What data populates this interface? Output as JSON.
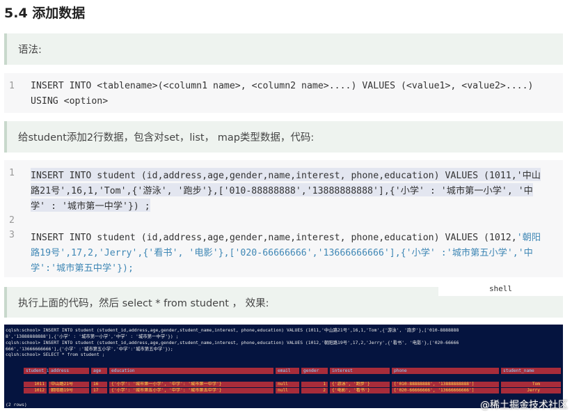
{
  "heading": "5.4 添加数据",
  "callout_syntax": "语法:",
  "syntax_code": {
    "line_numbers": [
      "1"
    ],
    "line1": "INSERT INTO <tablename>(<column1 name>, <column2 name>....) VALUES (<value1>, <value2>....)",
    "line1b": "USING <option>"
  },
  "callout_desc": "给student添加2行数据，包含对set，list， map类型数据，代码:",
  "example_code": {
    "ln1": "1",
    "ln2": "2",
    "ln3": "3",
    "l1a": "INSERT INTO student (id,address,age,gender,name,interest, phone,education) VALUES (1011,'中山",
    "l1b": "路21号',16,1,'Tom',{'游泳', '跑步'},['010-88888888','13888888888'],{'小学' : '城市第一小学', '中",
    "l1c": "学' : '城市第一中学'}) ;",
    "l3a_pre": "INSERT INTO student (id,address,age,gender,name,interest, phone,education) VALUES (1012,",
    "l3a_str": "'朝阳",
    "l3b": "路19号',17,2,'Jerry',{'看书', '电影'},['020-66666666','13666666666'],{'小学' :'城市第五小学','中",
    "l3c": "学':'城市第五中学'});"
  },
  "shell_tag": "shell",
  "callout_run": "执行上面的代码，然后 select * from student ， 效果:",
  "terminal": {
    "lines": [
      "cqlsh:school> INSERT INTO student (student_id,address,age,gender,student_name,interest, phone,education) VALUES (1011,'中山路21号',16,1,'Tom',{'游泳', '跑步'},['010-8888888",
      "8','13888888888'],{'小学' : '城市第一小学','中学' : '城市第一中学'}) ;",
      "cqlsh:school> INSERT INTO student (student_id,address,age,gender,student_name,interest, phone,education) VALUES (1012,'朝阳路19号',17,2,'Jerry',{'看书', '电影'},['020-66666",
      "666','13666666666'],{'小学' :'城市第五小学','中学':'城市第五中学'});",
      "cqlsh:school> SELECT * from student ;"
    ],
    "headers": [
      "student_id",
      "address",
      "age",
      "education",
      "email",
      "gender",
      "interest",
      "phone",
      "student_name"
    ],
    "rows": [
      [
        "1011",
        "中山路21号",
        "16",
        "{'小学': '城市第一小学', '中学': '城市第一中学'}",
        "null",
        "1",
        "{'游泳', '跑步'}",
        "['010-88888888', '13888888888']",
        "Tom"
      ],
      [
        "1012",
        "朝阳路19号",
        "17",
        "{'小学': '城市第五小学', '中学': '城市第五中学'}",
        "null",
        "2",
        "{'电影', '看书'}",
        "['020-66666666', '13666666666']",
        "Jerry"
      ]
    ],
    "footer": "(2 rows)"
  },
  "watermark": "@稀土掘金技术社区",
  "colors": {
    "callout_bg": "#eef3ef",
    "code_bg": "#f7f7f8",
    "highlight": "#e3e6f0",
    "string": "#3f87b5",
    "terminal_bg": "#05143f",
    "terminal_table": "#a82c3a"
  }
}
